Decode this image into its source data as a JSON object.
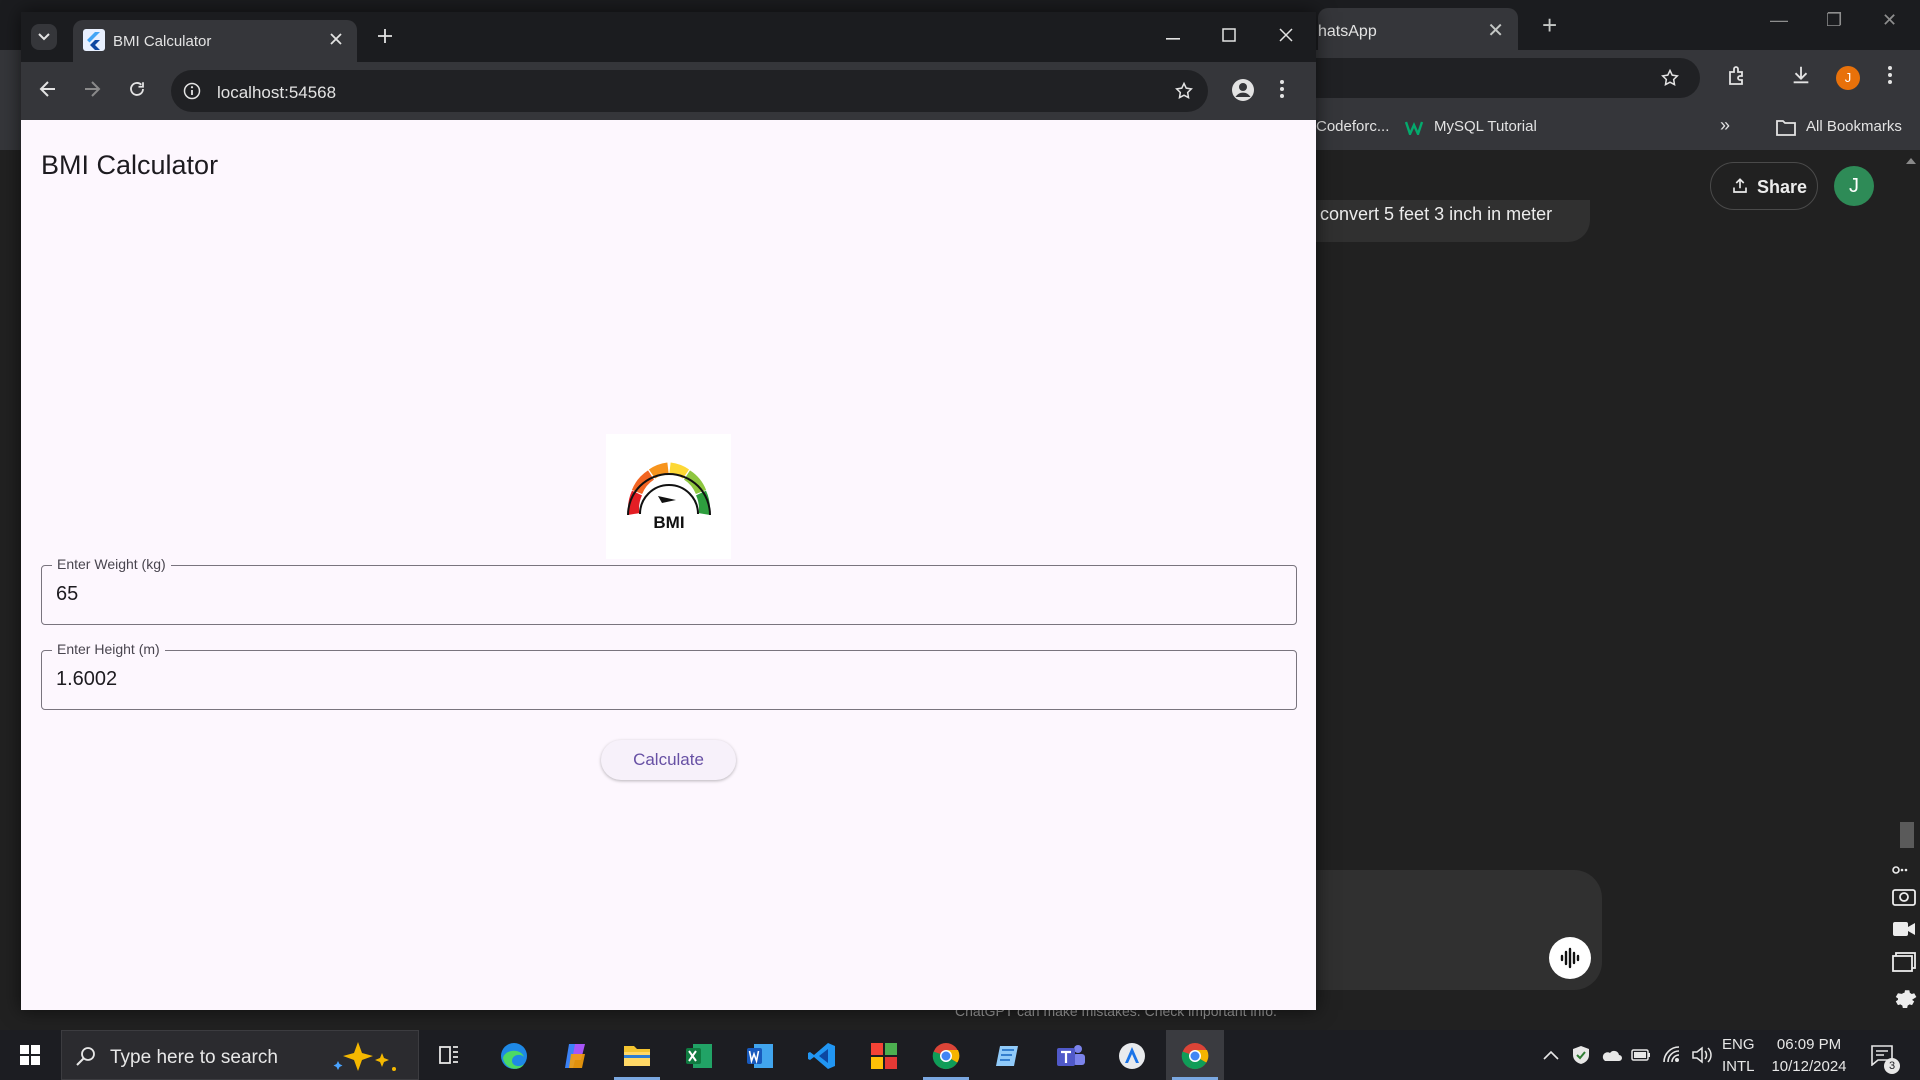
{
  "background_window": {
    "tab_title": "hatsApp",
    "bookmarks": [
      "Codeforc...",
      "MySQL Tutorial",
      "All Bookmarks"
    ],
    "share_label": "Share",
    "avatar_initial": "J",
    "message_snippet": "convert 5 feet 3 inch in meter",
    "footnote": "ChatGPT can make mistakes. Check important info."
  },
  "browser": {
    "tab_title": "BMI Calculator",
    "url": "localhost:54568"
  },
  "app": {
    "title": "BMI Calculator",
    "logo_text": "BMI",
    "weight_label": "Enter Weight (kg)",
    "weight_value": "65",
    "height_label": "Enter Height (m)",
    "height_value": "1.6002",
    "calculate_label": "Calculate"
  },
  "taskbar": {
    "search_placeholder": "Type here to search",
    "language_top": "ENG",
    "language_bottom": "INTL",
    "time": "06:09 PM",
    "date": "10/12/2024",
    "notification_count": "3"
  },
  "colors": {
    "app_background": "#fdf7fe",
    "accent": "#6750a4",
    "chrome_dark": "#35363a",
    "taskbar": "#1c1d22"
  }
}
